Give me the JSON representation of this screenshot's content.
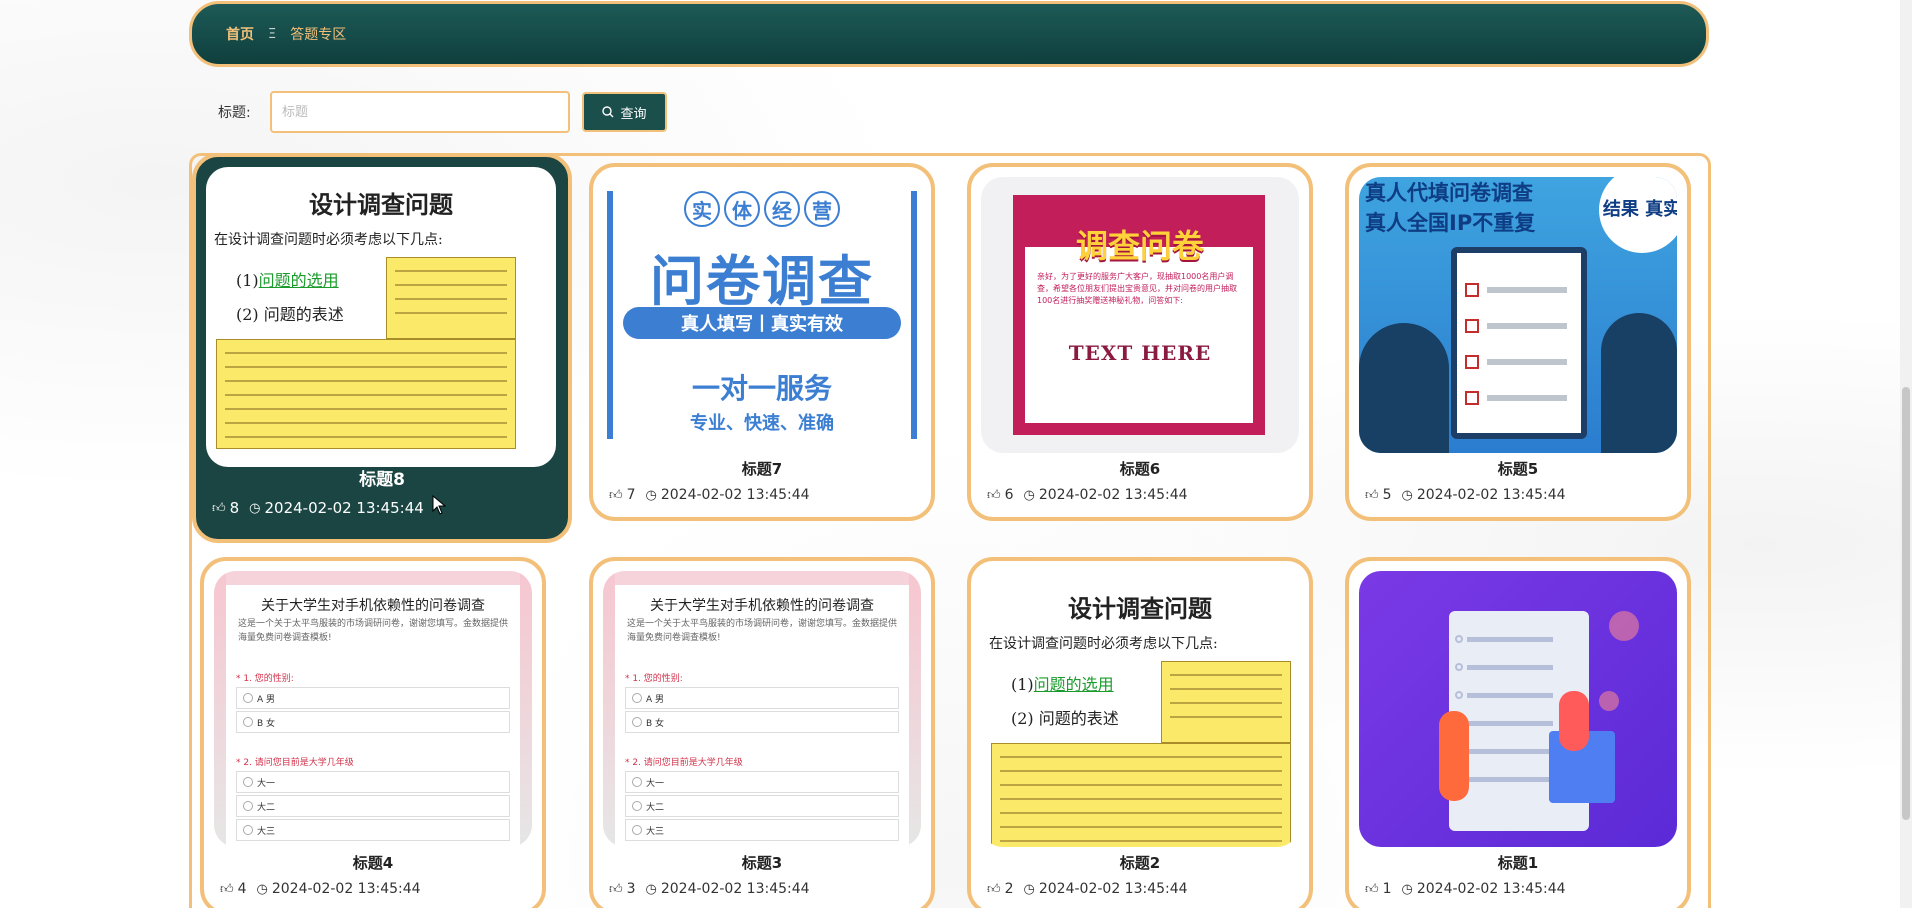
{
  "breadcrumb": {
    "home": "首页",
    "separator": "Ξ",
    "current": "答题专区"
  },
  "search": {
    "label": "标题:",
    "placeholder": "标题",
    "button_label": "查询",
    "button_icon": "search-icon"
  },
  "colors": {
    "accent": "#f3c07a",
    "header": "#1a4f4c",
    "active_card": "#1a4543"
  },
  "cards": [
    {
      "title": "标题8",
      "likes": "8",
      "time": "2024-02-02 13:45:44",
      "thumb": "design"
    },
    {
      "title": "标题7",
      "likes": "7",
      "time": "2024-02-02 13:45:44",
      "thumb": "entity"
    },
    {
      "title": "标题6",
      "likes": "6",
      "time": "2024-02-02 13:45:44",
      "thumb": "wj"
    },
    {
      "title": "标题5",
      "likes": "5",
      "time": "2024-02-02 13:45:44",
      "thumb": "ip"
    },
    {
      "title": "标题4",
      "likes": "4",
      "time": "2024-02-02 13:45:44",
      "thumb": "phone"
    },
    {
      "title": "标题3",
      "likes": "3",
      "time": "2024-02-02 13:45:44",
      "thumb": "phone"
    },
    {
      "title": "标题2",
      "likes": "2",
      "time": "2024-02-02 13:45:44",
      "thumb": "design"
    },
    {
      "title": "标题1",
      "likes": "1",
      "time": "2024-02-02 13:45:44",
      "thumb": "flat"
    }
  ],
  "thumbs": {
    "design": {
      "heading": "设计调查问题",
      "intro": "在设计调查问题时必须考虑以下几点:",
      "opt1_prefix": "(1)",
      "opt1": "问题的选用",
      "opt2": "(2) 问题的表述"
    },
    "entity": {
      "circles": [
        "实",
        "体",
        "经",
        "营"
      ],
      "big": "问卷调查",
      "pill": "真人填写丨真实有效",
      "mid": "一对一服务",
      "small": "专业、快速、准确"
    },
    "wj": {
      "heading": "调查问卷",
      "body": "亲好，为了更好的服务广大客户，现抽取1000名用户调查，希望各位朋友们提出宝贵意见，并对问卷的用户抽取100名进行抽奖赠送神秘礼物，问答如下:",
      "text_here": "TEXT HERE"
    },
    "ip": {
      "line1": "真人代填问卷调查",
      "line2": "真人全国IP不重复",
      "badge": "结果 真实"
    },
    "phone": {
      "heading": "关于大学生对手机依赖性的问卷调查",
      "sub": "这是一个关于太平鸟服装的市场调研问卷，谢谢您填写。金数据提供海量免费问卷调查模板!",
      "q1": "* 1. 您的性别:",
      "q1_opts": [
        "A 男",
        "B 女"
      ],
      "q2": "* 2. 请问您目前是大学几年级",
      "q2_opts": [
        "大一",
        "大二",
        "大三"
      ]
    }
  }
}
